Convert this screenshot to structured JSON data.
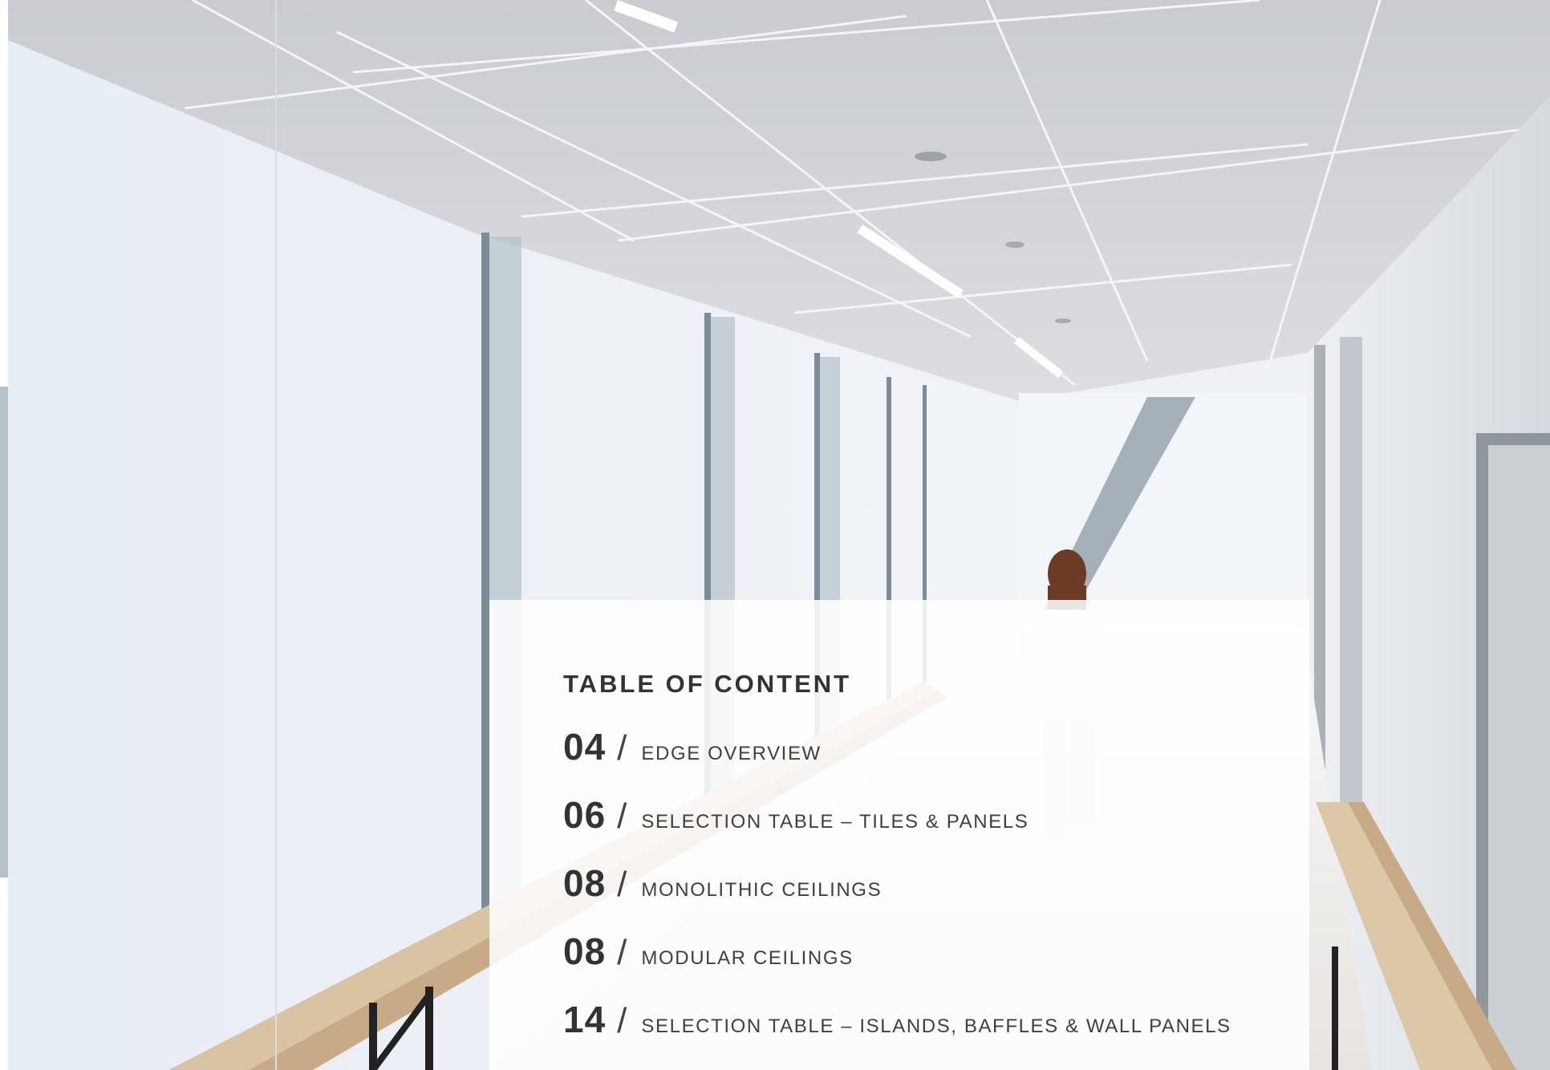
{
  "toc": {
    "title": "TABLE OF CONTENT",
    "separator": "/",
    "items": [
      {
        "page": "04",
        "label": "EDGE OVERVIEW"
      },
      {
        "page": "06",
        "label": "SELECTION TABLE – TILES & PANELS"
      },
      {
        "page": "08",
        "label": "MONOLITHIC CEILINGS"
      },
      {
        "page": "08",
        "label": "MODULAR CEILINGS"
      },
      {
        "page": "14",
        "label": "SELECTION TABLE – ISLANDS, BAFFLES & WALL PANELS"
      }
    ]
  },
  "colors": {
    "text": "#333333",
    "panel": "#ffffff",
    "side_strip": "#b6c2c8"
  }
}
